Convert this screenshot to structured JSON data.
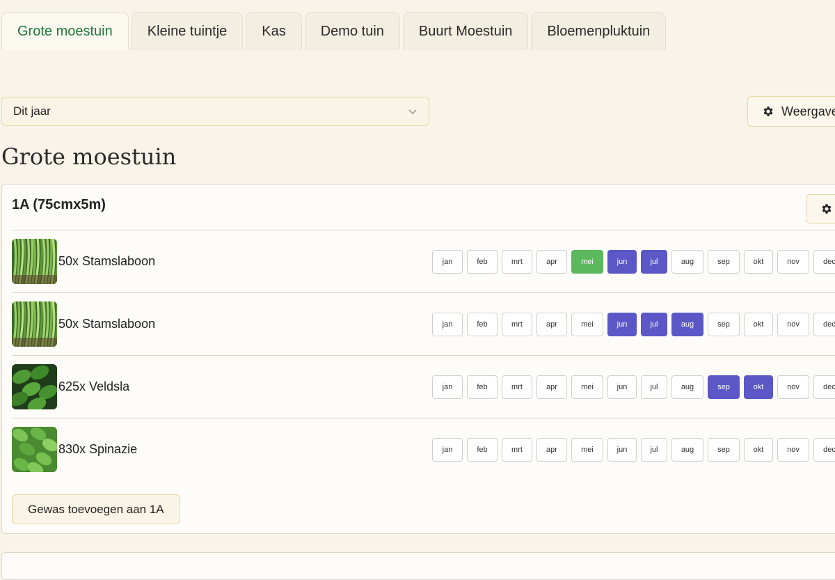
{
  "tabs": [
    {
      "label": "Grote moestuin",
      "active": true
    },
    {
      "label": "Kleine tuintje",
      "active": false
    },
    {
      "label": "Kas",
      "active": false
    },
    {
      "label": "Demo tuin",
      "active": false
    },
    {
      "label": "Buurt Moestuin",
      "active": false
    },
    {
      "label": "Bloemenpluktuin",
      "active": false
    }
  ],
  "filter": {
    "year_value": "Dit jaar",
    "view_button_label": "Weergave"
  },
  "page_title": "Grote moestuin",
  "bed": {
    "title": "1A (75cmx5m)",
    "add_button_label": "Gewas toevoegen aan 1A",
    "months": [
      "jan",
      "feb",
      "mrt",
      "apr",
      "mei",
      "jun",
      "jul",
      "aug",
      "sep",
      "okt",
      "nov",
      "dec"
    ],
    "plants": [
      {
        "label": "50x Stamslaboon",
        "image": "bean-plant-photo",
        "sow": [
          "mei"
        ],
        "harvest": [
          "jun",
          "jul"
        ]
      },
      {
        "label": "50x Stamslaboon",
        "image": "bean-plant-photo",
        "sow": [],
        "harvest": [
          "jun",
          "jul",
          "aug"
        ]
      },
      {
        "label": "625x Veldsla",
        "image": "lambs-lettuce-photo",
        "sow": [],
        "harvest": [
          "sep",
          "okt"
        ]
      },
      {
        "label": "830x Spinazie",
        "image": "spinach-photo",
        "sow": [],
        "harvest": []
      }
    ]
  },
  "colors": {
    "background": "#f8f4ea",
    "active_tab_text": "#1f7a3a",
    "sow": "#5cb85c",
    "harvest": "#5b57c6",
    "border_accent": "#e7d7a6"
  },
  "icons": {
    "settings": "gear-icon",
    "dropdown": "chevron-down-icon"
  }
}
